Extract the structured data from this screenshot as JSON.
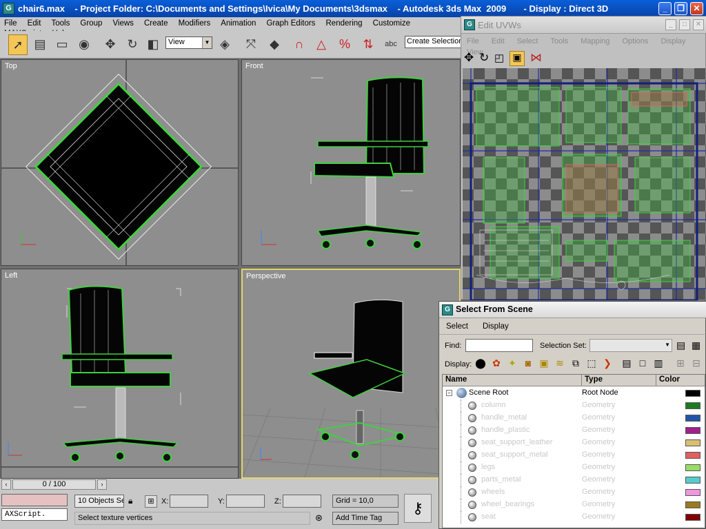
{
  "window": {
    "title": "chair6.max    - Project Folder: C:\\Documents and Settings\\Ivica\\My Documents\\3dsmax    - Autodesk 3ds Max  2009       - Display : Direct 3D",
    "icon_letter": "G",
    "minimize": "_",
    "maximize": "❐",
    "close": "✕"
  },
  "menubar": {
    "items": [
      "File",
      "Edit",
      "Tools",
      "Group",
      "Views",
      "Create",
      "Modifiers",
      "Animation",
      "Graph Editors",
      "Rendering",
      "Customize",
      "MAXScript",
      "Help"
    ]
  },
  "toolbar": {
    "view_dropdown": "View",
    "create_selection": "Create Selection",
    "icons": [
      "select-arrow-icon",
      "select-by-name-icon",
      "rect-select-icon",
      "window-crossing-icon",
      "move-icon",
      "rotate-icon",
      "scale-icon",
      "mirror-icon",
      "align-icon",
      "snap3-icon",
      "angle-snap-icon",
      "percent-snap-icon",
      "spinner-snap-icon"
    ]
  },
  "viewports": {
    "top": "Top",
    "front": "Front",
    "left": "Left",
    "perspective": "Perspective"
  },
  "edit_uvw": {
    "title": "Edit UVWs",
    "menu": [
      "File",
      "Edit",
      "Select",
      "Tools",
      "Mapping",
      "Options",
      "Display",
      "View"
    ]
  },
  "select_from_scene": {
    "title": "Select From Scene",
    "menu": [
      "Select",
      "Display"
    ],
    "find_label": "Find:",
    "find_value": "",
    "selection_set_label": "Selection Set:",
    "display_label": "Display:",
    "columns": [
      "Name",
      "Type",
      "Color"
    ],
    "root": {
      "name": "Scene Root",
      "type": "Root Node",
      "color": "#000000"
    },
    "rows": [
      {
        "name": "column",
        "type": "Geometry",
        "color": "#1e7a1e"
      },
      {
        "name": "handle_metal",
        "type": "Geometry",
        "color": "#2255aa"
      },
      {
        "name": "handle_plastic",
        "type": "Geometry",
        "color": "#a0208a"
      },
      {
        "name": "seat_support_leather",
        "type": "Geometry",
        "color": "#d8c070"
      },
      {
        "name": "seat_support_metal",
        "type": "Geometry",
        "color": "#e06060"
      },
      {
        "name": "legs",
        "type": "Geometry",
        "color": "#99dd66"
      },
      {
        "name": "parts_metal",
        "type": "Geometry",
        "color": "#55cccc"
      },
      {
        "name": "wheels",
        "type": "Geometry",
        "color": "#ee99dd"
      },
      {
        "name": "wheel_bearings",
        "type": "Geometry",
        "color": "#9a7a20"
      },
      {
        "name": "seat",
        "type": "Geometry",
        "color": "#800000"
      }
    ]
  },
  "statusbar": {
    "frame": "0 / 100",
    "objects": "10 Objects Se",
    "x_label": "X:",
    "y_label": "Y:",
    "z_label": "Z:",
    "grid": "Grid = 10,0",
    "listener": "AXScript.",
    "prompt": "Select texture vertices",
    "add_time_tag": "Add Time Tag"
  }
}
